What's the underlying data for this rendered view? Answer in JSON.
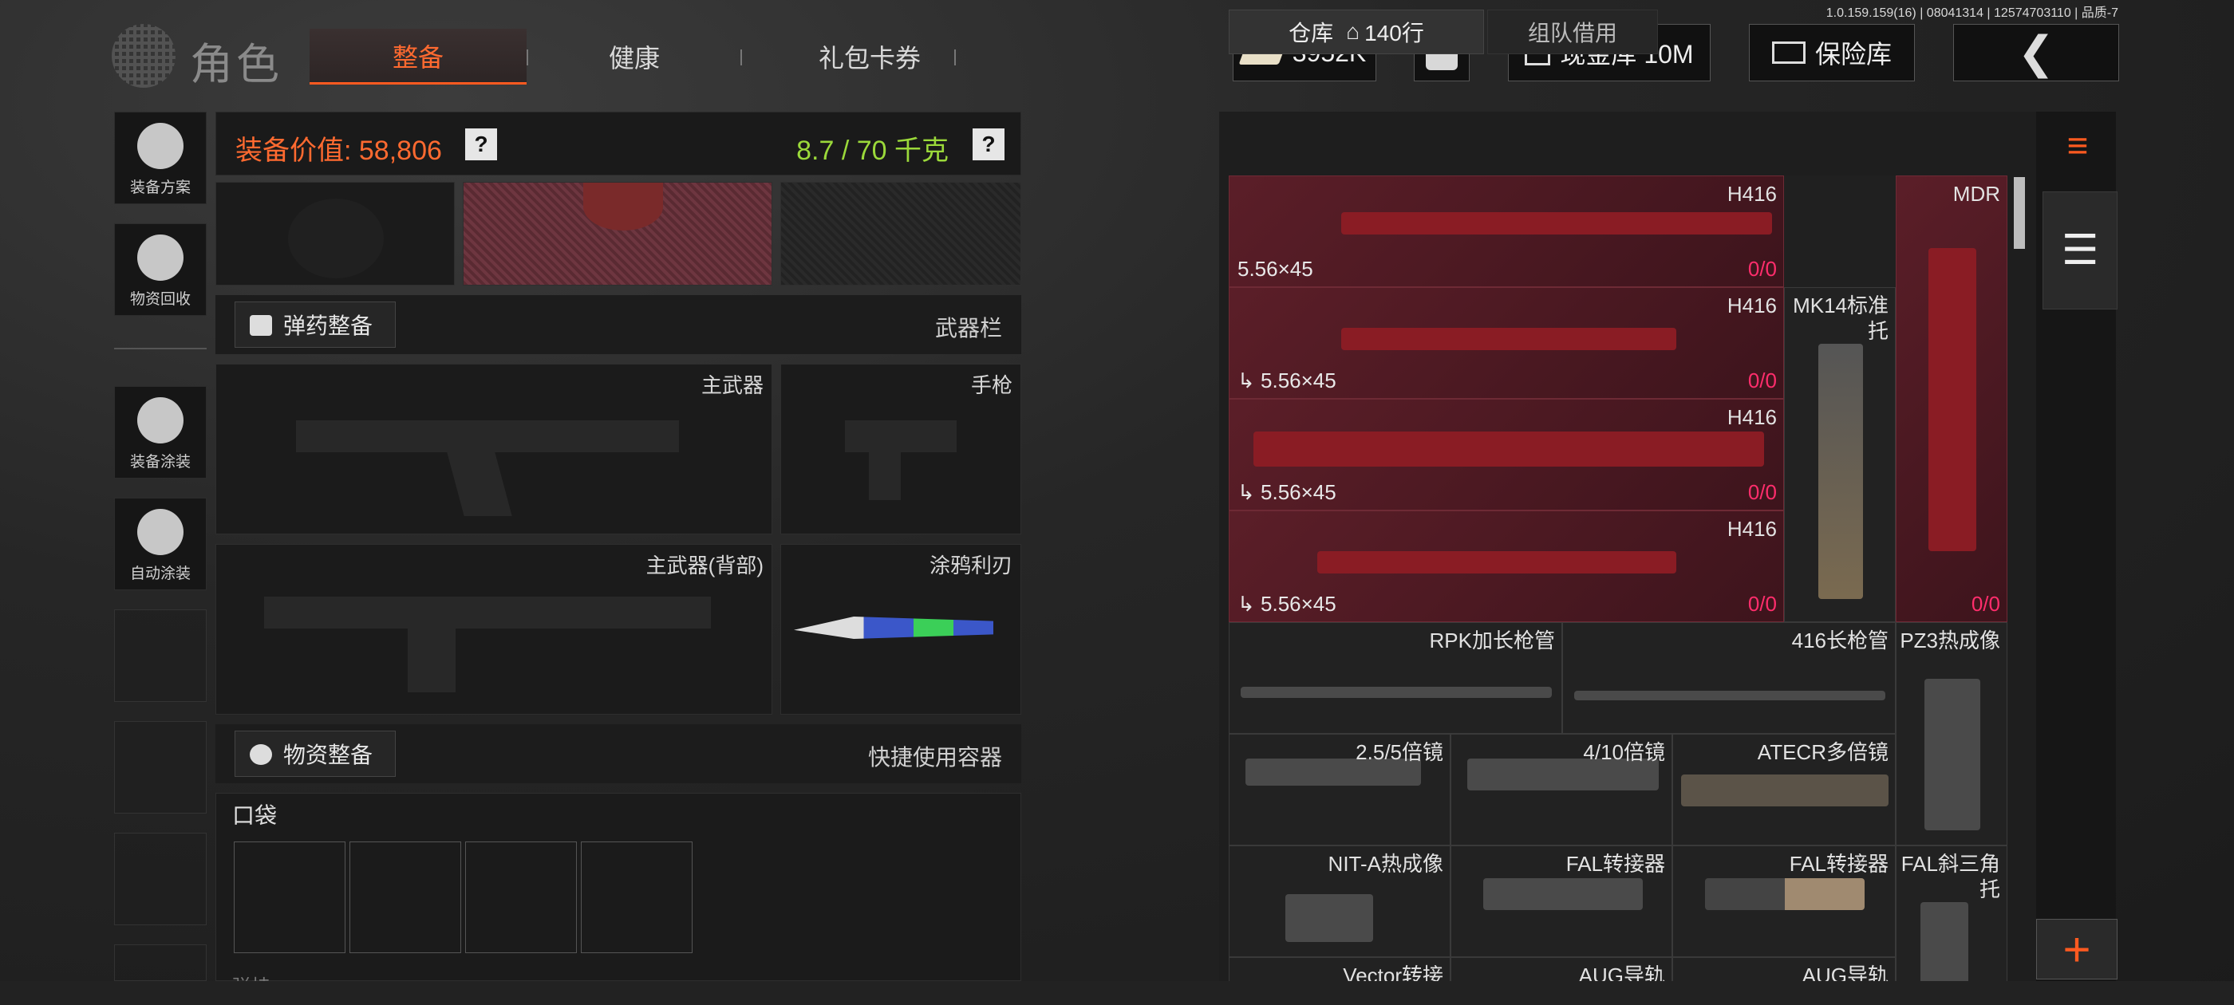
{
  "version": "1.0.159.159(16) | 08041314 | 12574703110 | 品质-7",
  "header": {
    "title": "角色",
    "tabs": [
      {
        "label": "整备",
        "active": true
      },
      {
        "label": "健康",
        "active": false
      },
      {
        "label": "礼包卡券",
        "active": false
      }
    ],
    "currency": "3952K",
    "cash_vault": "现金库 10M",
    "safe_box": "保险库"
  },
  "sidebar": {
    "items": [
      {
        "label": "装备方案",
        "icon": "loadout-icon"
      },
      {
        "label": "物资回收",
        "icon": "recycle-icon"
      },
      {
        "label": "装备涂装",
        "icon": "skin-icon"
      },
      {
        "label": "自动涂装",
        "icon": "auto-paint-icon"
      }
    ]
  },
  "equipment": {
    "value_label": "装备价值: 58,806",
    "weight_label": "8.7 / 70 千克",
    "help": "?",
    "ammo_button": "弹药整备",
    "weapon_bar": "武器栏",
    "primary": "主武器",
    "pistol": "手枪",
    "primary_back": "主武器(背部)",
    "melee": "涂鸦利刃",
    "supply_button": "物资整备",
    "quick_container": "快捷使用容器",
    "pocket": "口袋",
    "cut_off_label": "弹挂"
  },
  "warehouse": {
    "tab_storage": "仓库",
    "tab_rows": "140行",
    "tab_team": "组队借用",
    "items": [
      {
        "name": "H416",
        "caliber": "5.56×45",
        "count_a": "0",
        "count_b": "0"
      },
      {
        "name": "MDR",
        "caliber": "",
        "count_a": "0",
        "count_b": "0"
      },
      {
        "name": "H416",
        "caliber": "5.56×45",
        "count_a": "0",
        "count_b": "0"
      },
      {
        "name": "MK14标准托",
        "caliber": "",
        "count_a": "",
        "count_b": ""
      },
      {
        "name": "H416",
        "caliber": "5.56×45",
        "count_a": "0",
        "count_b": "0"
      },
      {
        "name": "H416",
        "caliber": "5.56×45",
        "count_a": "0",
        "count_b": "0"
      },
      {
        "name": "RPK加长枪管"
      },
      {
        "name": "416长枪管"
      },
      {
        "name": "PZ3热成像"
      },
      {
        "name": "2.5/5倍镜"
      },
      {
        "name": "4/10倍镜"
      },
      {
        "name": "ATECR多倍镜"
      },
      {
        "name": "NIT-A热成像"
      },
      {
        "name": "FAL转接器"
      },
      {
        "name": "FAL转接器"
      },
      {
        "name": "FAL斜三角托"
      },
      {
        "name": "Vector转接"
      },
      {
        "name": "AUG导轨"
      },
      {
        "name": "AUG导轨"
      }
    ]
  },
  "colors": {
    "accent": "#ff5a20",
    "value": "#ff6a30",
    "weight": "#9bd93a",
    "count": "#ff2d6c",
    "red_cell": "#5b1e28"
  }
}
